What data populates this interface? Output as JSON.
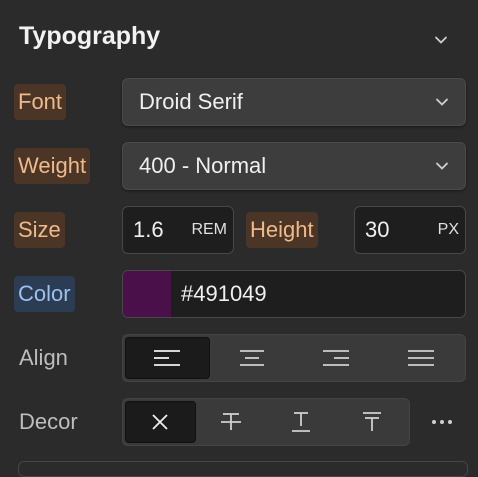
{
  "section": {
    "title": "Typography"
  },
  "font": {
    "label": "Font",
    "value": "Droid Serif"
  },
  "weight": {
    "label": "Weight",
    "value": "400 - Normal"
  },
  "size": {
    "label": "Size",
    "value": "1.6",
    "unit": "REM"
  },
  "height": {
    "label": "Height",
    "value": "30",
    "unit": "PX"
  },
  "color": {
    "label": "Color",
    "value": "#491049",
    "swatch": "#491049"
  },
  "align": {
    "label": "Align",
    "options": [
      "align-left-icon",
      "align-center-icon",
      "align-right-icon",
      "align-justify-icon"
    ],
    "active": "align-left-icon"
  },
  "decor": {
    "label": "Decor",
    "options": [
      "none-icon",
      "strikethrough-icon",
      "underline-icon",
      "overline-icon"
    ],
    "active": "none-icon"
  },
  "colors": {
    "set_label_bg": "#4a3526",
    "set_label_text": "#f0b98a",
    "inherited_label_bg": "#2c3c52",
    "inherited_label_text": "#9bc1ee"
  }
}
